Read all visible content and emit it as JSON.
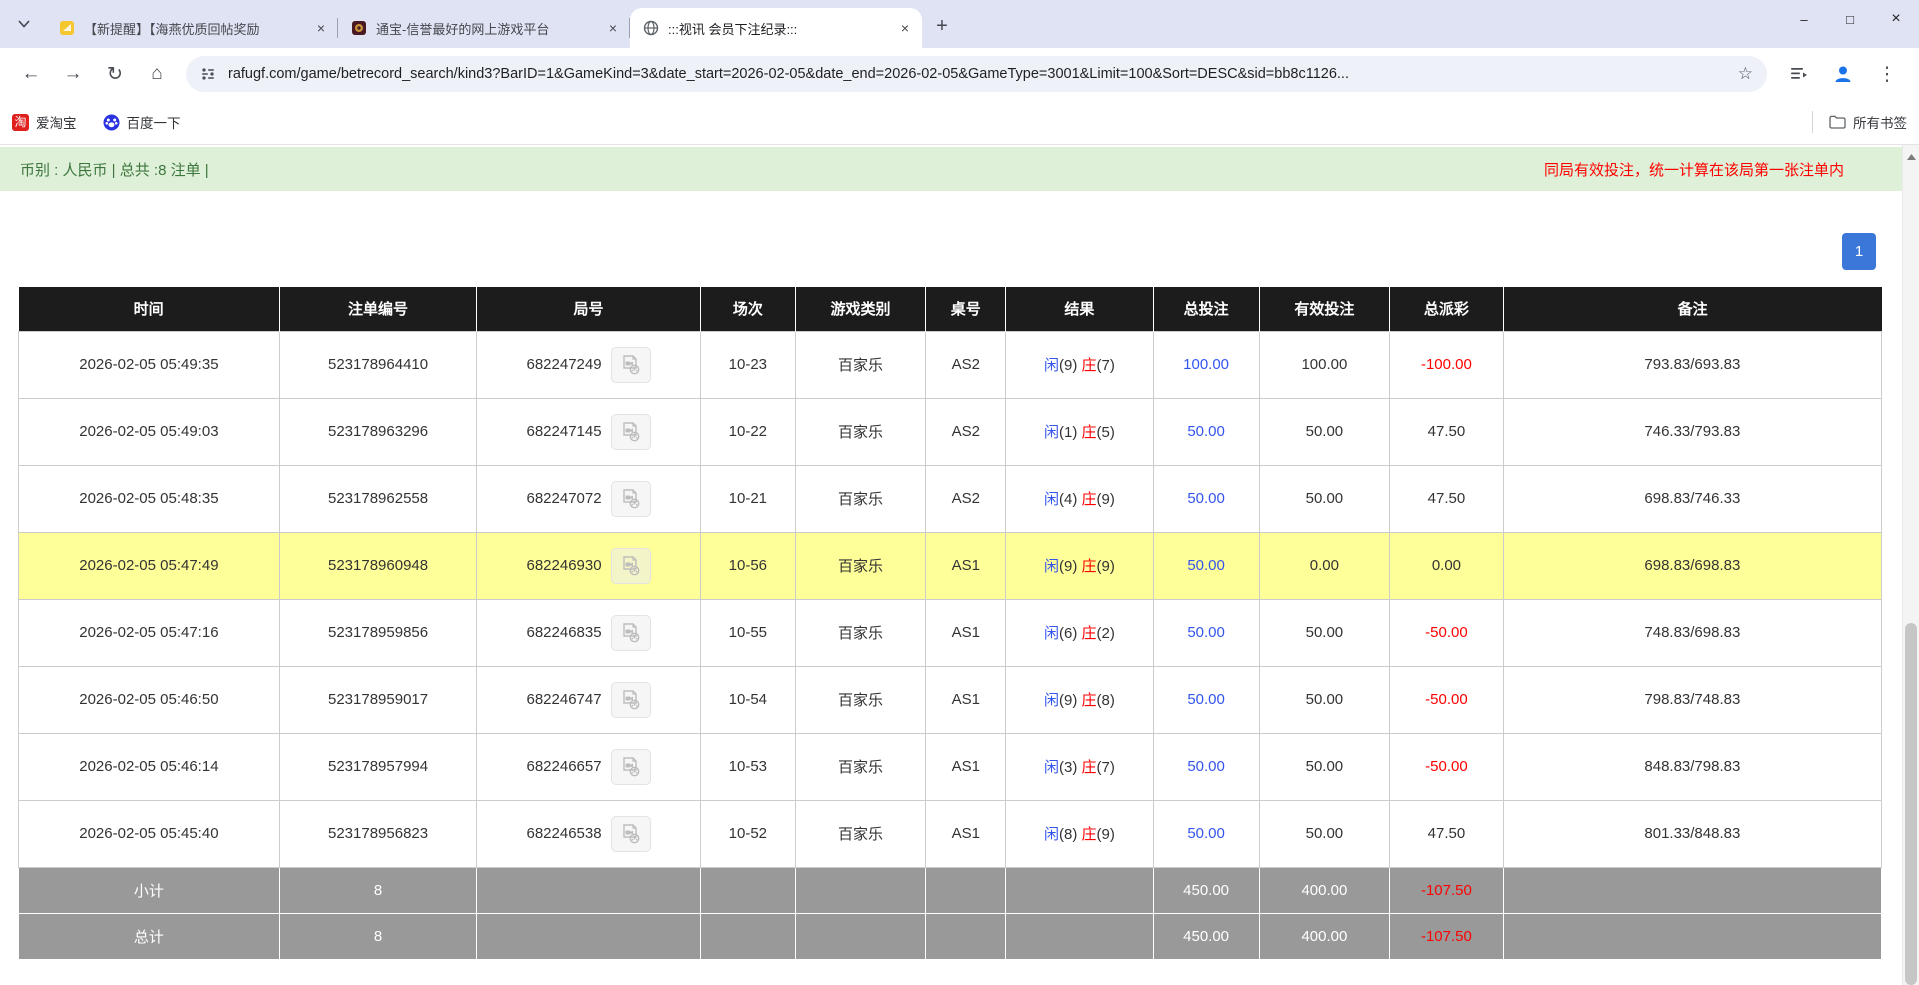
{
  "browser": {
    "tabs": [
      {
        "title": "【新提醒】【海燕优质回帖奖励"
      },
      {
        "title": "通宝-信誉最好的网上游戏平台"
      },
      {
        "title": ":::视讯 会员下注纪录:::"
      }
    ],
    "close_glyph": "×",
    "new_tab_glyph": "+",
    "window": {
      "minimize": "–",
      "maximize": "□",
      "close": "×"
    },
    "nav": {
      "back": "←",
      "forward": "→",
      "reload": "↻",
      "home": "⌂",
      "star": "☆",
      "menu": "⋮"
    },
    "url": "rafugf.com/game/betrecord_search/kind3?BarID=1&GameKind=3&date_start=2026-02-05&date_end=2026-02-05&GameType=3001&Limit=100&Sort=DESC&sid=bb8c1126...",
    "bookmarks": [
      {
        "label": "爱淘宝",
        "icon_glyph": "淘"
      },
      {
        "label": "百度一下"
      }
    ],
    "all_bookmarks_label": "所有书签"
  },
  "info_bar": {
    "left": "币别 : 人民币 | 总共 :8 注单 |",
    "right": "同局有效投注，统一计算在该局第一张注单内"
  },
  "pagination": {
    "current_page": "1"
  },
  "colors": {
    "highlight_row": "#ffff99",
    "header_bg": "#1c1c1c",
    "footer_bg": "#999999",
    "bet_blue": "#3355ee",
    "loss_red": "#ff0000",
    "infobar_bg": "#dff0d8",
    "infobar_text": "#3c763d",
    "page_btn_bg": "#3a77d9"
  },
  "table": {
    "headers": [
      "时间",
      "注单编号",
      "局号",
      "场次",
      "游戏类别",
      "桌号",
      "结果",
      "总投注",
      "有效投注",
      "总派彩",
      "备注"
    ],
    "rows": [
      {
        "time": "2026-02-05 05:49:35",
        "bet_id": "523178964410",
        "round_id": "682247249",
        "session": "10-23",
        "game": "百家乐",
        "table_no": "AS2",
        "player": "闲",
        "player_score": "(9)",
        "banker": "庄",
        "banker_score": "(7)",
        "total_bet": "100.00",
        "valid_bet": "100.00",
        "payout": "-100.00",
        "note": "793.83/693.83",
        "highlight": false
      },
      {
        "time": "2026-02-05 05:49:03",
        "bet_id": "523178963296",
        "round_id": "682247145",
        "session": "10-22",
        "game": "百家乐",
        "table_no": "AS2",
        "player": "闲",
        "player_score": "(1)",
        "banker": "庄",
        "banker_score": "(5)",
        "total_bet": "50.00",
        "valid_bet": "50.00",
        "payout": "47.50",
        "note": "746.33/793.83",
        "highlight": false
      },
      {
        "time": "2026-02-05 05:48:35",
        "bet_id": "523178962558",
        "round_id": "682247072",
        "session": "10-21",
        "game": "百家乐",
        "table_no": "AS2",
        "player": "闲",
        "player_score": "(4)",
        "banker": "庄",
        "banker_score": "(9)",
        "total_bet": "50.00",
        "valid_bet": "50.00",
        "payout": "47.50",
        "note": "698.83/746.33",
        "highlight": false
      },
      {
        "time": "2026-02-05 05:47:49",
        "bet_id": "523178960948",
        "round_id": "682246930",
        "session": "10-56",
        "game": "百家乐",
        "table_no": "AS1",
        "player": "闲",
        "player_score": "(9)",
        "banker": "庄",
        "banker_score": "(9)",
        "total_bet": "50.00",
        "valid_bet": "0.00",
        "payout": "0.00",
        "note": "698.83/698.83",
        "highlight": true
      },
      {
        "time": "2026-02-05 05:47:16",
        "bet_id": "523178959856",
        "round_id": "682246835",
        "session": "10-55",
        "game": "百家乐",
        "table_no": "AS1",
        "player": "闲",
        "player_score": "(6)",
        "banker": "庄",
        "banker_score": "(2)",
        "total_bet": "50.00",
        "valid_bet": "50.00",
        "payout": "-50.00",
        "note": "748.83/698.83",
        "highlight": false
      },
      {
        "time": "2026-02-05 05:46:50",
        "bet_id": "523178959017",
        "round_id": "682246747",
        "session": "10-54",
        "game": "百家乐",
        "table_no": "AS1",
        "player": "闲",
        "player_score": "(9)",
        "banker": "庄",
        "banker_score": "(8)",
        "total_bet": "50.00",
        "valid_bet": "50.00",
        "payout": "-50.00",
        "note": "798.83/748.83",
        "highlight": false
      },
      {
        "time": "2026-02-05 05:46:14",
        "bet_id": "523178957994",
        "round_id": "682246657",
        "session": "10-53",
        "game": "百家乐",
        "table_no": "AS1",
        "player": "闲",
        "player_score": "(3)",
        "banker": "庄",
        "banker_score": "(7)",
        "total_bet": "50.00",
        "valid_bet": "50.00",
        "payout": "-50.00",
        "note": "848.83/798.83",
        "highlight": false
      },
      {
        "time": "2026-02-05 05:45:40",
        "bet_id": "523178956823",
        "round_id": "682246538",
        "session": "10-52",
        "game": "百家乐",
        "table_no": "AS1",
        "player": "闲",
        "player_score": "(8)",
        "banker": "庄",
        "banker_score": "(9)",
        "total_bet": "50.00",
        "valid_bet": "50.00",
        "payout": "47.50",
        "note": "801.33/848.83",
        "highlight": false
      }
    ],
    "subtotal": {
      "label": "小计",
      "count": "8",
      "total_bet": "450.00",
      "valid_bet": "400.00",
      "payout": "-107.50"
    },
    "total": {
      "label": "总计",
      "count": "8",
      "total_bet": "450.00",
      "valid_bet": "400.00",
      "payout": "-107.50"
    }
  }
}
